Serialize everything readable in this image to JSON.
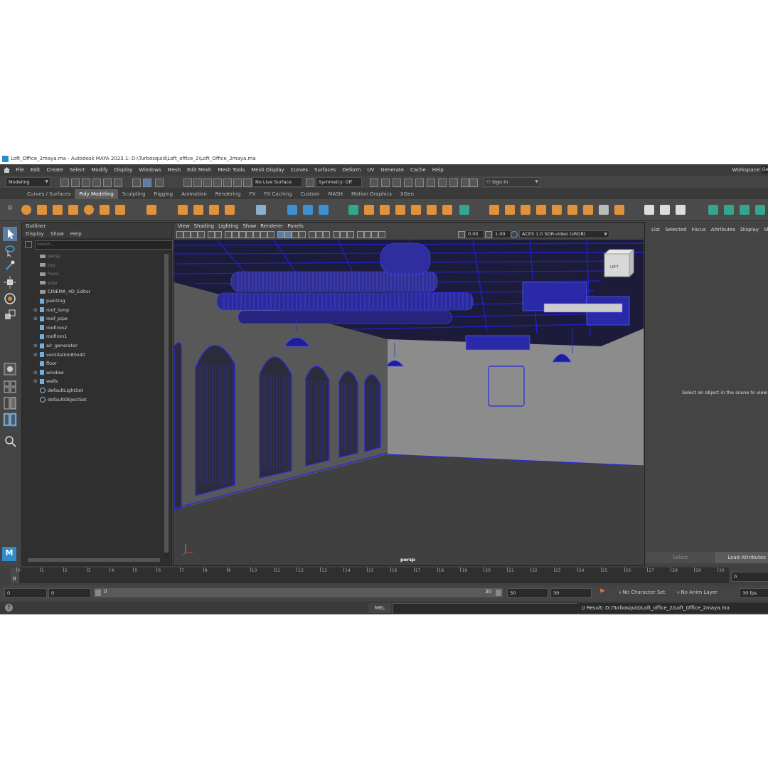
{
  "window": {
    "title": "Loft_Office_2maya.ma - Autodesk MAYA 2023.1: D:\\Turbosquid\\Loft_office_2\\Loft_Office_2maya.ma"
  },
  "menu": {
    "items": [
      "File",
      "Edit",
      "Create",
      "Select",
      "Modify",
      "Display",
      "Windows",
      "Mesh",
      "Edit Mesh",
      "Mesh Tools",
      "Mesh Display",
      "Curves",
      "Surfaces",
      "Deform",
      "UV",
      "Generate",
      "Cache",
      "Help"
    ],
    "workspace_label": "Workspace:",
    "workspace_value": "Ge"
  },
  "status_line": {
    "mode": "Modeling",
    "live_surface": "No Live Surface",
    "symmetry": "Symmetry: Off",
    "sign_in": "Sign In"
  },
  "shelf": {
    "tabs": [
      "Curves / Surfaces",
      "Poly Modeling",
      "Sculpting",
      "Rigging",
      "Animation",
      "Rendering",
      "FX",
      "FX Caching",
      "Custom",
      "MASH",
      "Motion Graphics",
      "XGen"
    ],
    "active_tab": "Poly Modeling",
    "icon_color": "#e0913a",
    "accent_blue": "#3c8fd1",
    "accent_green": "#34a58e"
  },
  "outliner": {
    "title": "Outliner",
    "menu": [
      "Display",
      "Show",
      "Help"
    ],
    "search_placeholder": "Search...",
    "items": [
      {
        "label": "persp",
        "dim": true,
        "expand": false,
        "icon": "camera-icon"
      },
      {
        "label": "top",
        "dim": true,
        "expand": false,
        "icon": "camera-icon"
      },
      {
        "label": "front",
        "dim": true,
        "expand": false,
        "icon": "camera-icon"
      },
      {
        "label": "side",
        "dim": true,
        "expand": false,
        "icon": "camera-icon"
      },
      {
        "label": "CINEMA_4D_Editor",
        "dim": false,
        "expand": false,
        "icon": "camera-icon"
      },
      {
        "label": "painting",
        "dim": false,
        "expand": false,
        "icon": "mesh-icon"
      },
      {
        "label": "roof_lamp",
        "dim": false,
        "expand": true,
        "icon": "group-icon"
      },
      {
        "label": "roof_pipe",
        "dim": false,
        "expand": true,
        "icon": "group-icon"
      },
      {
        "label": "roofiron2",
        "dim": false,
        "expand": false,
        "icon": "mesh-icon"
      },
      {
        "label": "roofiron1",
        "dim": false,
        "expand": false,
        "icon": "mesh-icon"
      },
      {
        "label": "air_generator",
        "dim": false,
        "expand": true,
        "icon": "group-icon"
      },
      {
        "label": "ventilation80x40",
        "dim": false,
        "expand": true,
        "icon": "group-icon"
      },
      {
        "label": "floor",
        "dim": false,
        "expand": false,
        "icon": "mesh-icon"
      },
      {
        "label": "window",
        "dim": false,
        "expand": true,
        "icon": "group-icon"
      },
      {
        "label": "walls",
        "dim": false,
        "expand": true,
        "icon": "group-icon"
      },
      {
        "label": "defaultLightSet",
        "dim": false,
        "expand": false,
        "icon": "set-icon"
      },
      {
        "label": "defaultObjectSet",
        "dim": false,
        "expand": false,
        "icon": "set-icon"
      }
    ]
  },
  "viewport": {
    "menu": [
      "View",
      "Shading",
      "Lighting",
      "Show",
      "Renderer",
      "Panels"
    ],
    "exposure": "0.00",
    "gamma": "1.00",
    "color_space": "ACES 1.0 SDR-video (sRGB)",
    "camera_label": "persp",
    "cube_label": "LEFT",
    "wire_color": "#1a1ad0"
  },
  "attribute_editor": {
    "tabs": [
      "List",
      "Selected",
      "Focus",
      "Attributes",
      "Display",
      "Sh"
    ],
    "message": "Select an object in the scene to view",
    "select_button": "Select",
    "load_button": "Load Attributes"
  },
  "timeline": {
    "ticks": [
      "0",
      "1",
      "2",
      "3",
      "4",
      "5",
      "6",
      "7",
      "8",
      "9",
      "10",
      "11",
      "12",
      "13",
      "14",
      "15",
      "16",
      "17",
      "18",
      "19",
      "20",
      "21",
      "22",
      "23",
      "24",
      "25",
      "26",
      "27",
      "28",
      "29",
      "30"
    ],
    "current_frame": "0",
    "current_field": "0"
  },
  "range": {
    "start": "0",
    "start2": "0",
    "slider_start": "0",
    "slider_end": "30",
    "end": "30",
    "end2": "30",
    "character_set": "No Character Set",
    "anim_layer": "No Anim Layer",
    "fps": "30 fps"
  },
  "command_line": {
    "lang": "MEL",
    "result": "// Result: D:/Turbosquid/Loft_office_2/Loft_Office_2maya.ma"
  }
}
